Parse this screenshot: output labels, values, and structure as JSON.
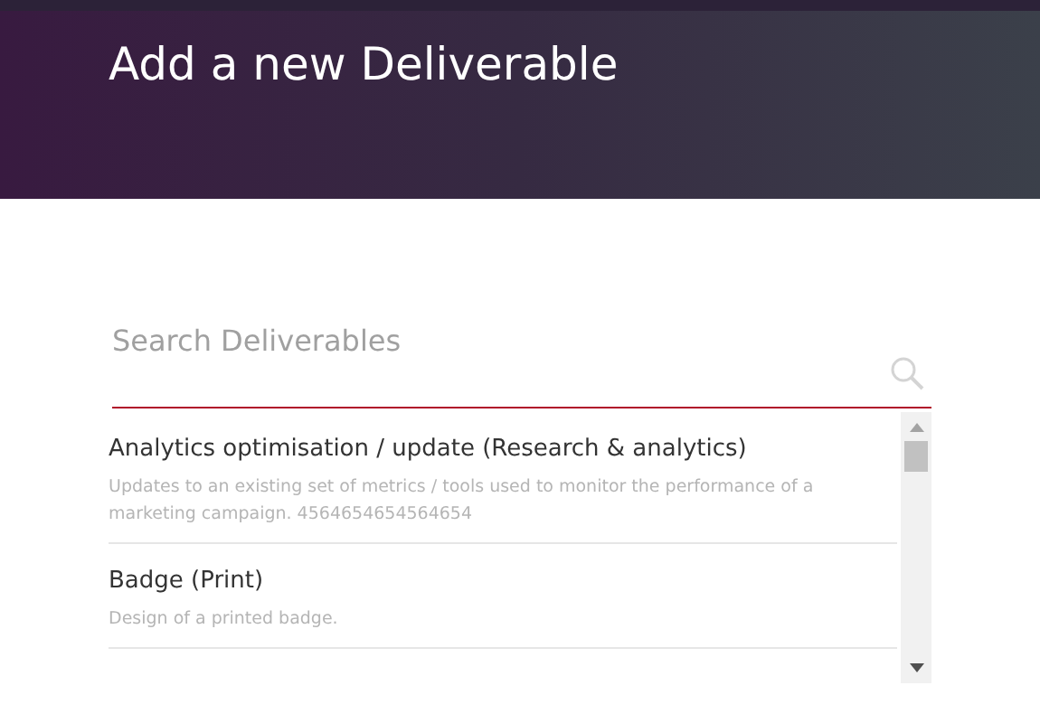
{
  "header": {
    "title": "Add a new Deliverable"
  },
  "search": {
    "placeholder": "Search Deliverables"
  },
  "results": [
    {
      "title": "Analytics optimisation / update (Research & analytics)",
      "description": "Updates to an existing set of metrics / tools used to monitor the performance of a marketing campaign. 4564654654564654"
    },
    {
      "title": "Badge (Print)",
      "description": "Design of a printed badge."
    }
  ]
}
